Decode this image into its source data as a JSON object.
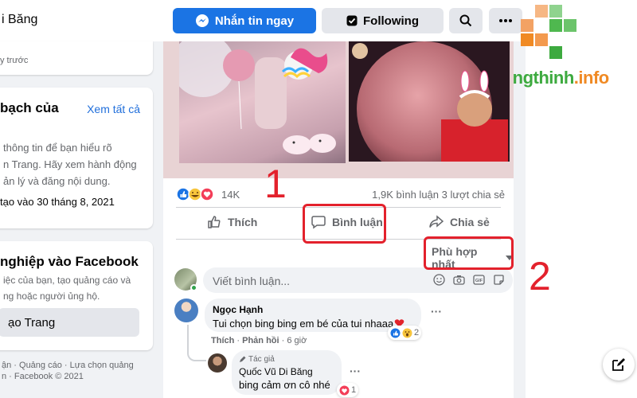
{
  "header": {
    "page_name": "i Băng",
    "message_label": "Nhắn tin ngay",
    "following_label": "Following"
  },
  "sidebar": {
    "card1_text": "y trước",
    "card2": {
      "heading": "bạch của",
      "see_all": "Xem tất cả",
      "desc": [
        "thông tin để bạn hiểu rõ",
        "n Trang. Hãy xem hành động",
        "ản lý và đăng nội dung."
      ],
      "created": "tạo vào 30 tháng 8, 2021"
    },
    "card3": {
      "heading": "nghiệp vào Facebook",
      "desc": [
        "iệc của bạn, tạo quảng cáo và",
        "ng hoặc người ủng hộ."
      ],
      "button": "ạo Trang"
    },
    "footer": [
      "ận · Quảng cáo · Lựa chọn quảng",
      "n · Facebook © 2021"
    ]
  },
  "post": {
    "reaction_count": "14K",
    "comments_shares": "1,9K bình luận  3 lượt chia sẻ",
    "like_label": "Thích",
    "comment_label": "Bình luận",
    "share_label": "Chia sẻ",
    "sort_label": "Phù hợp nhất",
    "composer_placeholder": "Viết bình luận..."
  },
  "comments": [
    {
      "author": "Ngọc Hạnh",
      "text": "Tui chọn bing bing em bé của tui nhaaa",
      "like": "Thích",
      "reply": "Phản hồi",
      "time": "6 giờ",
      "reactions": "2"
    }
  ],
  "reply": {
    "badge": "Tác giả",
    "author": "Quốc Vũ Di Băng",
    "text": "bing cảm ơn cô nhé",
    "reactions": "1"
  },
  "annotations": {
    "one": "1",
    "two": "2"
  },
  "logo": {
    "part1": "Truongthinh",
    "part2": ".info"
  },
  "colors": {
    "accent": "#1b74e4",
    "annotation": "#e3212c",
    "logo_green": "#3daa3f",
    "logo_orange": "#f08a24"
  }
}
